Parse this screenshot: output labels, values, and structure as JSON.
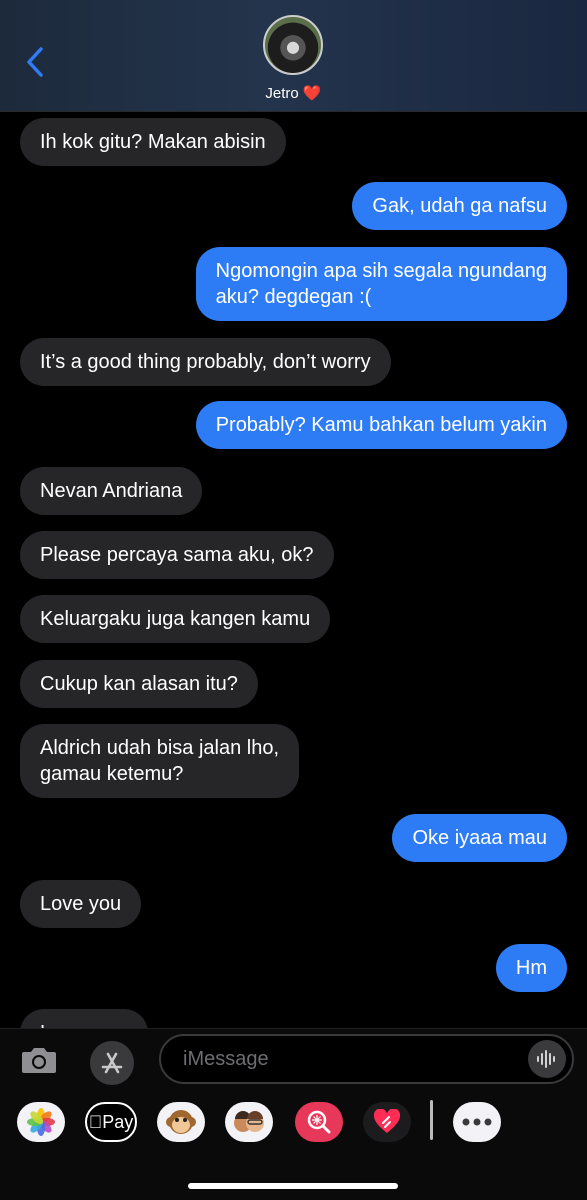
{
  "header": {
    "contact_name": "Jetro ❤️"
  },
  "messages": [
    {
      "side": "in",
      "text": "Ih kok gitu? Makan abisin"
    },
    {
      "side": "out",
      "text": "Gak, udah ga nafsu"
    },
    {
      "side": "out",
      "text": "Ngomongin apa sih segala ngundang\naku? degdegan :("
    },
    {
      "side": "in",
      "text": "It’s a good thing probably, don’t worry"
    },
    {
      "side": "out",
      "text": "Probably? Kamu bahkan belum yakin"
    },
    {
      "side": "in",
      "text": "Nevan Andriana"
    },
    {
      "side": "in",
      "text": "Please percaya sama aku, ok?"
    },
    {
      "side": "in",
      "text": "Keluargaku juga kangen kamu"
    },
    {
      "side": "in",
      "text": "Cukup kan alasan itu?"
    },
    {
      "side": "in",
      "text": "Aldrich udah bisa jalan lho,\ngamau ketemu?"
    },
    {
      "side": "out",
      "text": "Oke iyaaa mau"
    },
    {
      "side": "in",
      "text": "Love you"
    },
    {
      "side": "out",
      "text": "Hm"
    },
    {
      "side": "in",
      "text": "L"
    }
  ],
  "composer": {
    "placeholder": "iMessage"
  },
  "apps": {
    "items": [
      {
        "name": "photos-app-icon",
        "label": ""
      },
      {
        "name": "apple-pay-app-icon",
        "label": "Pay"
      },
      {
        "name": "monkey-memoji-icon",
        "label": ""
      },
      {
        "name": "memoji-stickers-icon",
        "label": ""
      },
      {
        "name": "image-search-app-icon",
        "label": ""
      },
      {
        "name": "digital-touch-heart-icon",
        "label": ""
      },
      {
        "name": "more-apps-icon",
        "label": ""
      }
    ]
  },
  "colors": {
    "outgoing": "#2d7cf6",
    "incoming": "#262629",
    "background": "#000000"
  }
}
